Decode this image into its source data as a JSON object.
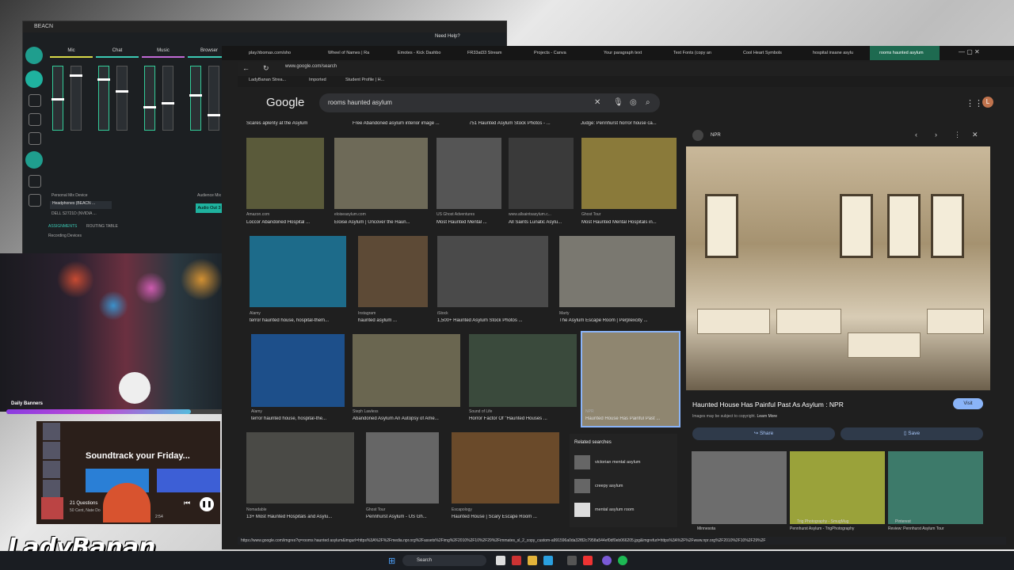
{
  "mixer": {
    "title": "BEACN",
    "need_help": "Need Help?",
    "channels": [
      {
        "label": "Mic",
        "color": "#d9d94a"
      },
      {
        "label": "Chat",
        "color": "#3bc9b4"
      },
      {
        "label": "Music",
        "color": "#c26ad6"
      },
      {
        "label": "Browser",
        "color": "#3bc9b4"
      }
    ],
    "personal_mix": "Personal Mix Device",
    "device": "Headphones (BEACN ...",
    "device2": "DELL S2721D (NVIDIA ...",
    "audience_mix": "Audience Mix D",
    "audio_out": "Audio Out 3",
    "tab_assignments": "ASSIGNMENTS",
    "tab_routing": "ROUTING TABLE",
    "recording_devices": "Recording Devices"
  },
  "stream": {
    "daily_banners": "Daily Banners",
    "progress_fraction": 0.75,
    "watermark": "LadyBanan__"
  },
  "spotify": {
    "heading": "Soundtrack your Friday...",
    "track": "21 Questions",
    "artist": "50 Cent, Nate Do",
    "time": "2:54"
  },
  "browser": {
    "tabs": [
      "play.hbomax.com/sho",
      "Wheel of Names | Ra",
      "Emotes - Kick Dashbo",
      "FR33at33 Stream",
      "Projects - Canva",
      "Your paragraph text",
      "Text Fonts (copy an",
      "Cool Heart Symbols",
      "hospital insane asylu",
      "rooms haunted asylum"
    ],
    "url": "www.google.com/search",
    "bookmarks": [
      "LadyBanan Strea...",
      "Imported",
      "Student Profile | H..."
    ],
    "query": "rooms haunted asylum",
    "logo": "Google",
    "avatar_letter": "L",
    "status_url": "https://www.google.com/imgres?q=rooms haunted asylum&imgurl=https%3A%2F%2Fmedia.npr.org%2Fassets%2Fimg%2F2010%2F10%2F29%2Fimmates_sl_2_copy_custom-a991596a0da32f82c7958a544ef0df0eb066205.jpg&imgrefurl=https%3A%2F%2Fwww.npr.org%2F2010%2F10%2F29%2F"
  },
  "results": {
    "top_row": [
      "Scares aplenty at the Asylum",
      "Free Abandoned asylum interior image ...",
      "751 Haunted Asylum Stock Photos - ...",
      "Judge: Pennhurst horror house ca..."
    ],
    "row1": [
      {
        "src": "Amazon.com",
        "caption": "Loccor Abandoned Hospital ..."
      },
      {
        "src": "eloiseasylum.com",
        "caption": "Eloise Asylum | Uncover the Haun..."
      },
      {
        "src": "US Ghost Adventures",
        "caption": "Most Haunted Mental ..."
      },
      {
        "src": "www.allsaintsasylum.c...",
        "caption": "All Saints Lunatic Asylu..."
      },
      {
        "src": "Ghost Tour",
        "caption": "Most Haunted Mental Hospitals in..."
      }
    ],
    "row2": [
      {
        "src": "Alamy",
        "caption": "terror haunted house, hospital-them..."
      },
      {
        "src": "Instagram",
        "caption": "haunted asylum ..."
      },
      {
        "src": "iStock",
        "caption": "1,500+ Haunted Asylum Stock Photos ..."
      },
      {
        "src": "Marty",
        "caption": "The Asylum Escape Room | Perplexcity ..."
      }
    ],
    "row3": [
      {
        "src": "Alamy",
        "caption": "terror haunted house, hospital-the..."
      },
      {
        "src": "Steph Lawless",
        "caption": "Abandoned Asylum An Autopsy of Ame..."
      },
      {
        "src": "Sound of Life",
        "caption": "Horror Factor Of \"Haunted Houses ..."
      },
      {
        "src": "NPR",
        "caption": "Haunted House Has Painful Past ..."
      }
    ],
    "row4": [
      {
        "src": "Nomadable",
        "caption": "13+ Most Haunted Hospitals and Asylu..."
      },
      {
        "src": "Ghost Tour",
        "caption": "Pennhurst Asylum - US Gh..."
      },
      {
        "src": "Escapology",
        "caption": "Haunted House | Scary Escape Room ..."
      }
    ]
  },
  "related": {
    "heading": "Related searches",
    "items": [
      "victorian mental asylum",
      "creepy asylum",
      "mental asylum room"
    ]
  },
  "panel": {
    "source": "NPR",
    "title": "Haunted House Has Painful Past As Asylum : NPR",
    "copyright": "Images may be subject to copyright.",
    "learn_more": "Learn More",
    "visit": "Visit",
    "share": "Share",
    "save": "Save",
    "related_images": [
      {
        "src": "Minnesota",
        "caption": ""
      },
      {
        "src": "Trig Photography - SmugMug",
        "caption": "Pennhurst Asylum - TrigPhotography"
      },
      {
        "src": "Pinterest",
        "caption": "Review: Pennhurst Asylum Tour"
      }
    ]
  },
  "taskbar": {
    "search": "Search"
  }
}
